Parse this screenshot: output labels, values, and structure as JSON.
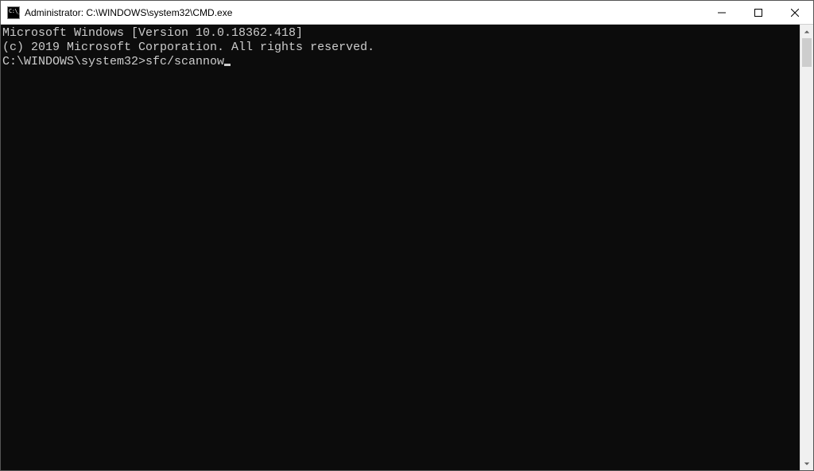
{
  "window": {
    "title": "Administrator: C:\\WINDOWS\\system32\\CMD.exe"
  },
  "terminal": {
    "line1": "Microsoft Windows [Version 10.0.18362.418]",
    "line2": "(c) 2019 Microsoft Corporation. All rights reserved.",
    "blank": "",
    "prompt": "C:\\WINDOWS\\system32>",
    "command": "sfc/scannow"
  }
}
